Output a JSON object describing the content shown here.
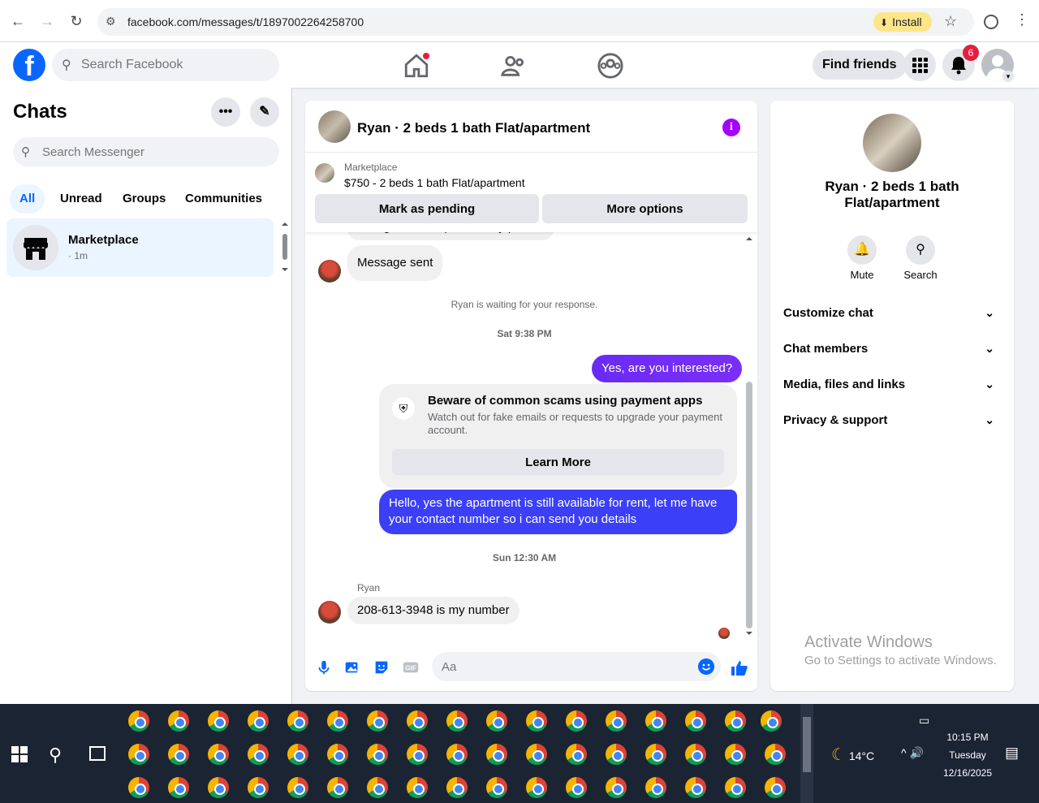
{
  "browser": {
    "url": "facebook.com/messages/t/1897002264258700",
    "install_label": "Install"
  },
  "header": {
    "search_placeholder": "Search Facebook",
    "find_friends": "Find friends",
    "notification_count": "6"
  },
  "sidebar": {
    "title": "Chats",
    "search_placeholder": "Search Messenger",
    "filters": [
      "All",
      "Unread",
      "Groups",
      "Communities"
    ],
    "chats": [
      {
        "name": "Marketplace",
        "time": "· 1m"
      }
    ]
  },
  "conversation": {
    "title": "Ryan · 2 beds 1 bath Flat/apartment",
    "marketplace_label": "Marketplace",
    "listing": "$750 - 2 beds 1 bath Flat/apartment",
    "mark_pending": "Mark as pending",
    "more_options": "More options",
    "messages": {
      "partial": "Hi Nigi, is this a pet-friendly place?",
      "sent": "Message sent",
      "waiting": "Ryan is waiting for your response.",
      "ts1": "Sat 9:38 PM",
      "out1": "Yes, are you interested?",
      "scam_title": "Beware of common scams using payment apps",
      "scam_desc": "Watch out for fake emails or requests to upgrade your payment account.",
      "learn_more": "Learn More",
      "out2": "Hello, yes the apartment is still available for rent, let me have your contact number so i can send you details",
      "ts2": "Sun 12:30 AM",
      "sender": "Ryan",
      "in_number": "208-613-3948 is my number"
    },
    "composer_placeholder": "Aa"
  },
  "details": {
    "name": "Ryan · 2 beds 1 bath Flat/apartment",
    "mute": "Mute",
    "search": "Search",
    "sections": [
      "Customize chat",
      "Chat members",
      "Media, files and links",
      "Privacy & support"
    ]
  },
  "watermark": {
    "line1": "Activate Windows",
    "line2": "Go to Settings to activate Windows."
  },
  "taskbar": {
    "temperature": "14°C",
    "time": "10:15 PM",
    "day": "Tuesday",
    "date": "12/16/2025"
  },
  "colors": {
    "fb_blue": "#0866ff",
    "outgoing": "#7b2ff7",
    "outgoing_alt": "#3b3ff6",
    "info_purple": "#a400ff"
  }
}
